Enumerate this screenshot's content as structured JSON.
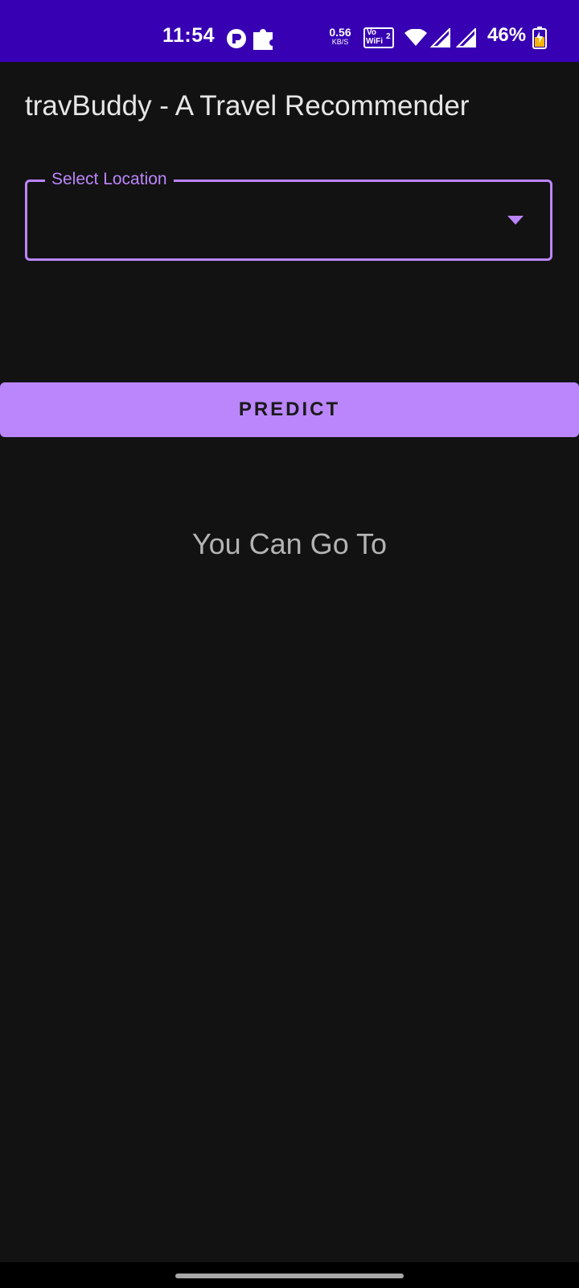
{
  "status_bar": {
    "time": "11:54",
    "net_speed_value": "0.56",
    "net_speed_unit": "KB/S",
    "vowifi_label_top": "Vo",
    "vowifi_label_bottom": "WiFi",
    "vowifi_sim": "2",
    "battery_percent": "46%",
    "icons": [
      "app-notification-icon",
      "puzzle-icon",
      "wifi-icon",
      "signal-sim1-icon",
      "signal-sim2-icon",
      "battery-charging-icon"
    ]
  },
  "app_bar": {
    "title": "travBuddy - A Travel Recommender"
  },
  "location_dropdown": {
    "label": "Select Location",
    "value": "",
    "icon": "dropdown-arrow-icon"
  },
  "predict_button": {
    "label": "PREDICT"
  },
  "result": {
    "heading": "You Can Go To"
  },
  "colors": {
    "status_bar": "#3700B3",
    "background": "#121212",
    "accent": "#BB86FC",
    "title_text": "#E6E6E6",
    "secondary_text": "#B3B3B3"
  }
}
